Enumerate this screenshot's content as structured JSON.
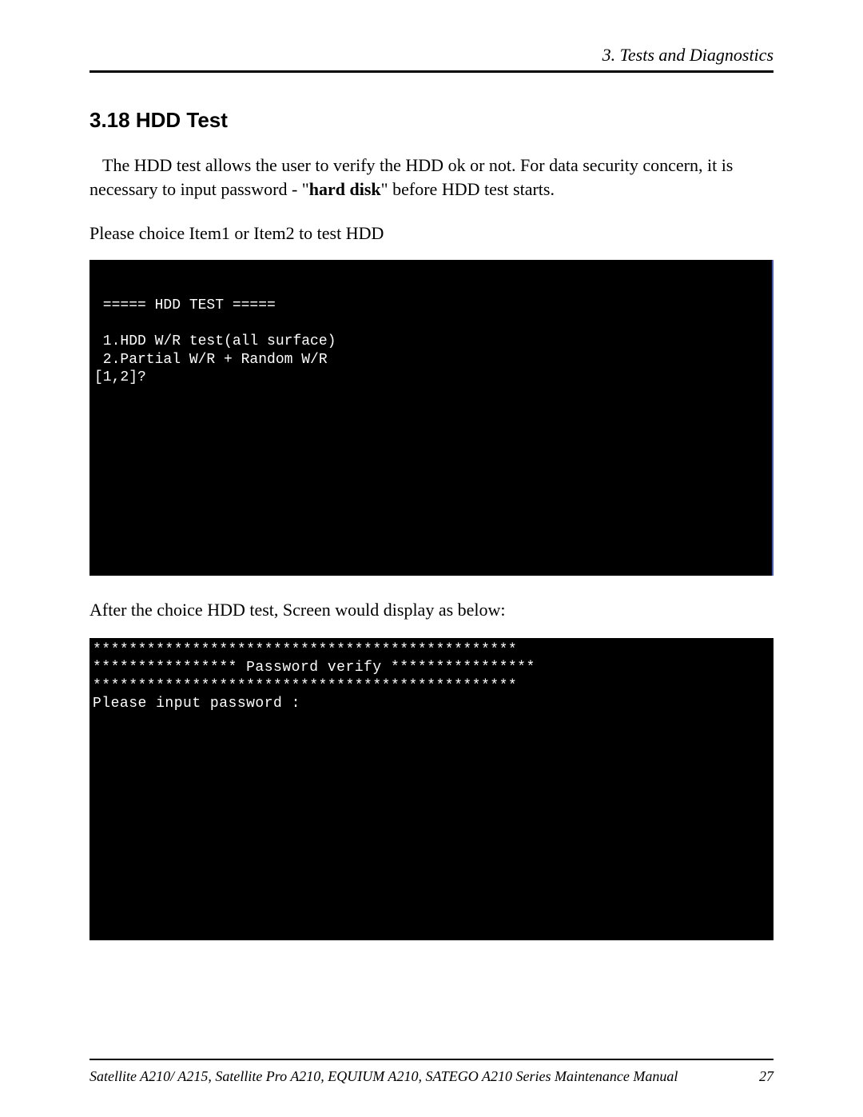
{
  "header": {
    "chapter": "3.  Tests and Diagnostics"
  },
  "section": {
    "number_title": "3.18  HDD Test"
  },
  "para1_pre": "The HDD test allows the user to verify the HDD ok or not. For data security concern, it is necessary to input password - \"",
  "para1_bold": "hard disk",
  "para1_post": "\" before HDD test starts.",
  "para2": "Please choice Item1 or Item2 to test HDD",
  "terminal1": {
    "l1": " ===== HDD TEST =====",
    "l2": "",
    "l3": " 1.HDD W/R test(all surface)",
    "l4": " 2.Partial W/R + Random W/R",
    "l5": "[1,2]?"
  },
  "para3": "After the choice HDD test, Screen would display as below:",
  "terminal2": {
    "l1": "***********************************************",
    "l2": "**************** Password verify ****************",
    "l3": "***********************************************",
    "l4": "Please input password :"
  },
  "footer": {
    "manual": "Satellite A210/ A215, Satellite Pro A210, EQUIUM A210, SATEGO A210 Series Maintenance Manual",
    "page": "27"
  }
}
